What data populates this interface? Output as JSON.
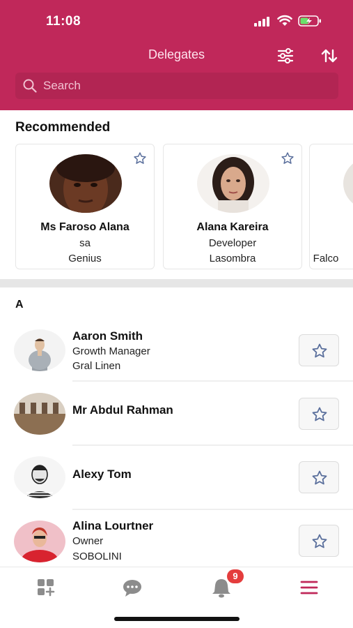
{
  "status": {
    "time": "11:08"
  },
  "header": {
    "title": "Delegates",
    "search_placeholder": "Search"
  },
  "recommended": {
    "title": "Recommended",
    "cards": [
      {
        "name": "Ms Faroso Alana",
        "role": "sa",
        "org": "Genius"
      },
      {
        "name": "Alana Kareira",
        "role": "Developer",
        "org": "Lasombra"
      },
      {
        "name": "",
        "role": "",
        "org": "Falco"
      }
    ]
  },
  "section": {
    "letter": "A"
  },
  "people": [
    {
      "name": "Aaron Smith",
      "role": "Growth Manager",
      "org": "Gral Linen"
    },
    {
      "name": "Mr Abdul Rahman",
      "role": "",
      "org": ""
    },
    {
      "name": "Alexy Tom",
      "role": "",
      "org": ""
    },
    {
      "name": "Alina Lourtner",
      "role": "Owner",
      "org": "SOBOLINI"
    }
  ],
  "tabbar": {
    "notifications_badge": "9",
    "icons": [
      "dashboard-icon",
      "chat-icon",
      "bell-icon",
      "menu-icon"
    ]
  },
  "colors": {
    "brand": "#c0285a",
    "star": "#5a6f9c",
    "badge": "#e43d3d",
    "tab_icon": "#8c8c8c"
  }
}
